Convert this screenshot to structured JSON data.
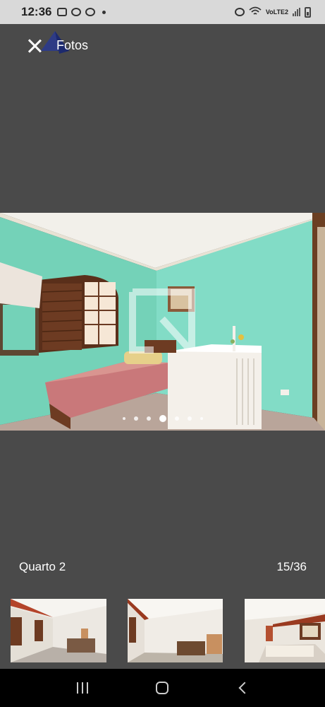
{
  "status_bar": {
    "time": "12:36",
    "network_label": "VoLTE2"
  },
  "header": {
    "title": "Fotos",
    "close_icon": "close-icon"
  },
  "gallery": {
    "caption": "Quarto 2",
    "counter": "15/36",
    "current_index": 15,
    "total": 36
  },
  "colors": {
    "background": "#4a4a4a",
    "status_bar": "#d9d9d9",
    "nav_bar": "#000000",
    "wall": "#7fd6be"
  },
  "thumbnails": [
    {
      "name": "thumbnail-1"
    },
    {
      "name": "thumbnail-2"
    },
    {
      "name": "thumbnail-3"
    }
  ],
  "nav_icons": [
    "recent-apps-icon",
    "home-icon",
    "back-icon"
  ]
}
